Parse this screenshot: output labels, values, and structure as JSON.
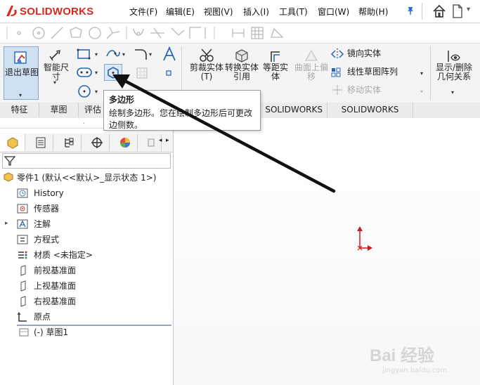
{
  "app": {
    "logo_text": "SOLIDWORKS",
    "logo_prefix": "3S",
    "brand_color": "#d52b1e"
  },
  "menu": {
    "items": [
      "文件(F)",
      "编辑(E)",
      "视图(V)",
      "插入(I)",
      "工具(T)",
      "窗口(W)",
      "帮助(H)"
    ]
  },
  "ribbon": {
    "exit_sketch": "退出草图",
    "smart_dim": "智能尺寸",
    "trim": "剪裁实体(T)",
    "convert": "转换实体引用",
    "offset": "等距实体",
    "offset_surface": "曲面上偏移",
    "mirror": "镜向实体",
    "linear_pattern": "线性草图阵列",
    "move": "移动实体",
    "relations": "显示/删除几何关系"
  },
  "tabs": {
    "items": [
      "特征",
      "草图",
      "评估",
      "SOLIDWORKS MBD",
      "SOLIDWORKS CAM"
    ]
  },
  "tooltip": {
    "title": "多边形",
    "body": "绘制多边形。您在绘制多边形后可更改边侧数。"
  },
  "tree": {
    "root": "零件1  (默认<<默认>_显示状态 1>)",
    "items": [
      "History",
      "传感器",
      "注解",
      "方程式",
      "材质 <未指定>",
      "前视基准面",
      "上视基准面",
      "右视基准面",
      "原点",
      "(-) 草图1"
    ]
  },
  "watermark": {
    "text": "Bai 经验",
    "sub": "jingyan.baidu.com"
  },
  "colors": {
    "ribbon_bg": "#f4f4f4",
    "accent_blue": "#1f6fc4",
    "origin_red": "#d01818"
  }
}
